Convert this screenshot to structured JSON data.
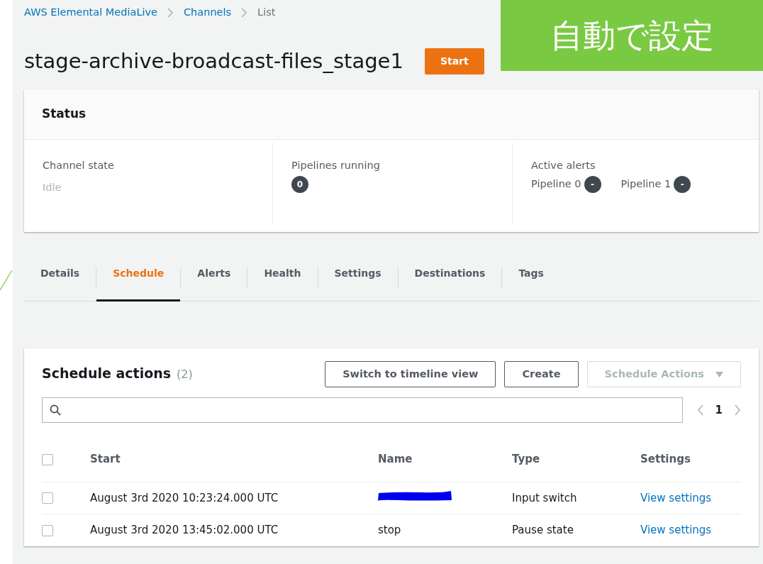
{
  "breadcrumb": [
    {
      "label": "AWS Elemental MediaLive",
      "link": true
    },
    {
      "label": "Channels",
      "link": true
    },
    {
      "label": "List",
      "link": false
    }
  ],
  "title": "stage-archive-broadcast-files_stage1",
  "start_button": "Start",
  "annotation": {
    "label": "自動で設定",
    "color": "#7ac943"
  },
  "status": {
    "title": "Status",
    "columns": [
      {
        "label": "Channel state",
        "items": [
          {
            "kind": "text",
            "text": "Idle"
          }
        ]
      },
      {
        "label": "Pipelines running",
        "items": [
          {
            "kind": "badge",
            "text": "0"
          }
        ]
      },
      {
        "label": "Active alerts",
        "items": [
          {
            "kind": "labeled_badge",
            "text": "Pipeline 0",
            "badge": "-"
          },
          {
            "kind": "labeled_badge",
            "text": "Pipeline 1",
            "badge": "-"
          }
        ]
      }
    ]
  },
  "tabs": [
    {
      "label": "Details",
      "selected": false
    },
    {
      "label": "Schedule",
      "selected": true
    },
    {
      "label": "Alerts",
      "selected": false
    },
    {
      "label": "Health",
      "selected": false
    },
    {
      "label": "Settings",
      "selected": false
    },
    {
      "label": "Destinations",
      "selected": false
    },
    {
      "label": "Tags",
      "selected": false
    }
  ],
  "schedule": {
    "title": "Schedule actions",
    "count": "(2)",
    "buttons": [
      {
        "label": "Switch to timeline view",
        "disabled": false,
        "dropdown": false
      },
      {
        "label": "Create",
        "disabled": false,
        "dropdown": false
      },
      {
        "label": "Schedule Actions",
        "disabled": true,
        "dropdown": true
      }
    ],
    "page": "1",
    "table": {
      "all_checked": false,
      "columns": [
        "Start",
        "Name",
        "Type",
        "Settings"
      ],
      "rows": [
        {
          "checked": false,
          "start": "August 3rd 2020 10:23:24.000 UTC",
          "name": {
            "kind": "redacted"
          },
          "type": "Input switch",
          "settings": "View settings"
        },
        {
          "checked": false,
          "start": "August 3rd 2020 13:45:02.000 UTC",
          "name": {
            "kind": "text",
            "text": "stop"
          },
          "type": "Pause state",
          "settings": "View settings"
        }
      ]
    }
  }
}
